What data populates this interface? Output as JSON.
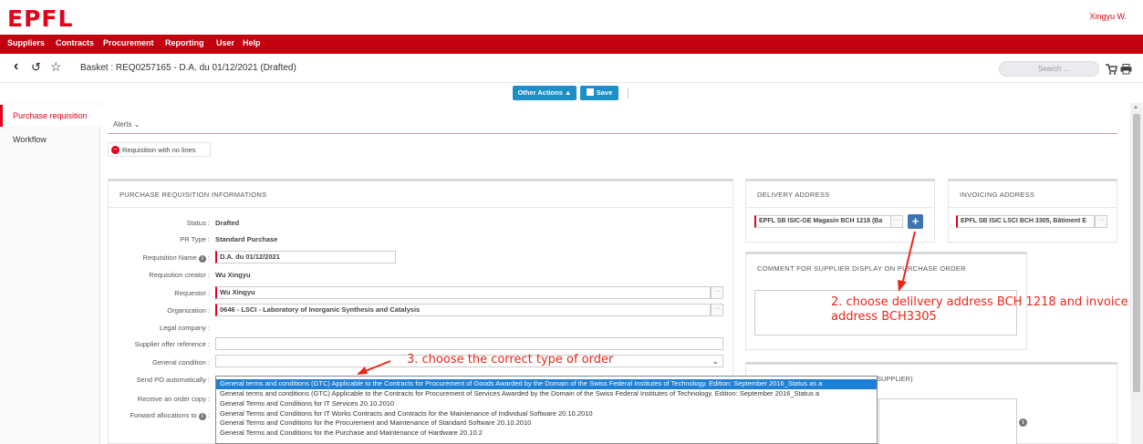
{
  "header": {
    "logo": "EPFL",
    "user_name": "Xingyu W."
  },
  "menu": {
    "items": [
      "Suppliers",
      "Contracts",
      "Procurement",
      "Reporting",
      "User",
      "Help"
    ]
  },
  "titlebar": {
    "title": "Basket : REQ0257165 - D.A. du 01/12/2021 (Drafted)",
    "search_placeholder": "Search ...",
    "back_icon": "chevron-left-icon",
    "history_icon": "history-icon",
    "favorite_icon": "star-icon",
    "cart_icon": "cart-icon",
    "print_icon": "print-icon"
  },
  "actions": {
    "other_actions": "Other Actions ▲",
    "save": "Save"
  },
  "leftnav": {
    "items": [
      "Purchase requisition",
      "Workflow"
    ]
  },
  "alerts": {
    "label": "Alerts",
    "message": "Requisition with no lines"
  },
  "pr_info": {
    "title": "PURCHASE REQUISITION INFORMATIONS",
    "fields": {
      "status_label": "Status :",
      "status_value": "Drafted",
      "prtype_label": "PR Type :",
      "prtype_value": "Standard Purchase",
      "reqname_label": "Requisition Name",
      "reqname_value": "D.A. du 01/12/2021",
      "creator_label": "Requisition creator :",
      "creator_value": "Wu Xingyu",
      "requestor_label": "Requestor :",
      "requestor_value": "Wu Xingyu",
      "org_label": "Organization :",
      "org_value": "0646 - LSCI - Laboratory of Inorganic Synthesis and Catalysis",
      "legal_label": "Legal company :",
      "offer_label": "Supplier offer reference :",
      "general_label": "General condition :",
      "sendpo_label": "Send PO automatically :",
      "receive_label": "Receive an order copy :",
      "forward_label": "Forward allocations to"
    }
  },
  "delivery": {
    "title": "DELIVERY ADDRESS",
    "value": "EPFL SB ISIC-GE Magasin BCH 1218 (Ba"
  },
  "invoicing": {
    "title": "INVOICING ADDRESS",
    "value": "EPFL SB ISIC LSCI BCH 3305, Bâtiment E"
  },
  "comment": {
    "title": "COMMENT FOR SUPPLIER DISPLAY ON PURCHASE ORDER"
  },
  "lower_panel": {
    "title_tail": "SUPPLIER)"
  },
  "dropdown": {
    "options": [
      "General terms and conditions (GTC) Applicable to the Contracts for Procurement of Goods Awarded by the Domain of the Swiss Federal Institutes of Technology. Edition: September 2016_Status as a",
      "General terms and conditions (GTC) Applicable to the Contracts for Procurement of Services Awarded by the Domain of the Swiss Federal Institutes of Technology. Edition: September 2016_Status a",
      "General Terms and Conditions for IT Services 20.10.2010",
      "General Terms and Conditions for IT Works Contracts and Contracts for the Maintenance of Individual Software 20.10.2010",
      "General Terms and Conditions for the Procurement and Maintenance of Standard Software 20.10.2010",
      "General Terms and Conditions for the Purchase and Maintenance of Hardware 20.10.2"
    ],
    "selected_index": 0
  },
  "annotations": {
    "delivery_note": "2. choose delilvery address BCH 1218 and invoice address BCH3305",
    "order_note": "3. choose the correct type of order"
  },
  "colors": {
    "brand_red": "#e2001a",
    "menu_red": "#c4000f",
    "button_blue": "#1c8fc9",
    "annotation_red": "#e8271a",
    "select_blue": "#1e7fd6"
  }
}
